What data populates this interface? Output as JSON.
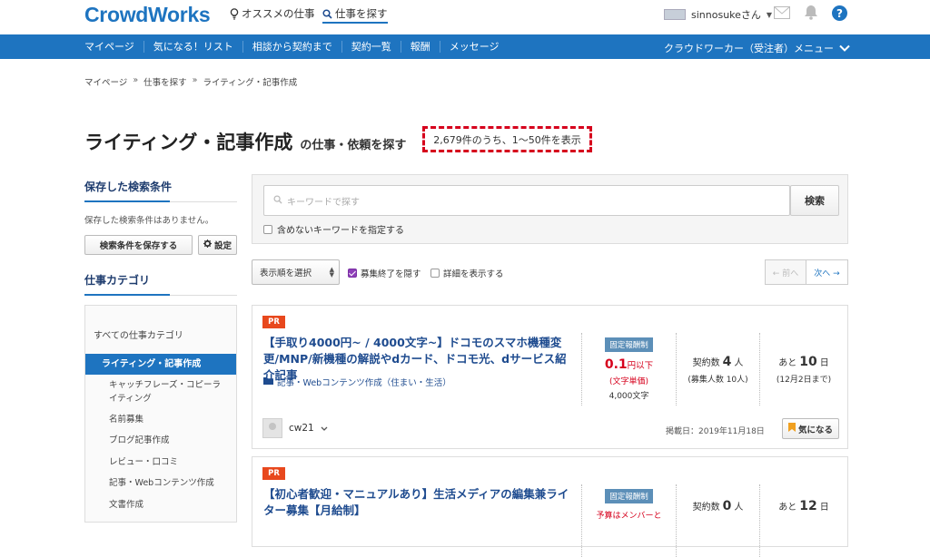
{
  "header": {
    "logo": "CrowdWorks",
    "recommend": "オススメの仕事",
    "find_jobs": "仕事を探す",
    "username": "sinnosukeさん"
  },
  "nav": {
    "items": [
      "マイページ",
      "気になる！リスト",
      "相談から契約まで",
      "契約一覧",
      "報酬",
      "メッセージ"
    ],
    "menu": "クラウドワーカー（受注者）メニュー"
  },
  "breadcrumb": {
    "items": [
      "マイページ",
      "仕事を探す",
      "ライティング・記事作成"
    ],
    "sep": "»"
  },
  "page": {
    "title": "ライティング・記事作成",
    "subtitle": "の仕事・依頼を探す",
    "count": "2,679件のうち、1〜50件を表示"
  },
  "sidebar": {
    "saved_title": "保存した検索条件",
    "saved_none": "保存した検索条件はありません。",
    "save_button": "検索条件を保存する",
    "settings_button": "設定",
    "category_title": "仕事カテゴリ",
    "all_categories": "すべての仕事カテゴリ",
    "active_category": "ライティング・記事作成",
    "subcategories": [
      "キャッチフレーズ・コピーライティング",
      "名前募集",
      "ブログ記事作成",
      "レビュー・口コミ",
      "記事・Webコンテンツ作成",
      "文書作成"
    ]
  },
  "search": {
    "placeholder": "キーワードで探す",
    "button": "検索",
    "exclude_label": "含めないキーワードを指定する"
  },
  "toolbar": {
    "sort": "表示順を選択",
    "hide_closed": "募集終了を隠す",
    "show_details": "詳細を表示する",
    "prev": "← 前へ",
    "next": "次へ →"
  },
  "jobs": [
    {
      "pr": "PR",
      "title": "【手取り4000円~ / 4000文字~】ドコモのスマホ機種変更/MNP/新機種の解説やdカード、ドコモ光、dサービス紹介記事",
      "category": "記事・Webコンテンツ作成（住まい・生活）",
      "pay_type": "固定報酬制",
      "price": "0.1",
      "price_unit": "円以下",
      "price_note": "(文字単価)",
      "chars": "4,000文字",
      "contracts_label": "契約数",
      "contracts": "4",
      "people": "人",
      "recruit": "(募集人数 10人)",
      "remaining_label": "あと",
      "remaining": "10",
      "days": "日",
      "deadline": "(12月2日まで)",
      "client": "cw21",
      "posted": "掲載日：2019年11月18日",
      "fav": "気になる"
    },
    {
      "pr": "PR",
      "title": "【初心者歓迎・マニュアルあり】生活メディアの編集兼ライター募集【月給制】",
      "pay_type": "固定報酬制",
      "price_note": "予算はメンバーと",
      "contracts_label": "契約数",
      "contracts": "0",
      "people": "人",
      "remaining_label": "あと",
      "remaining": "12",
      "days": "日"
    }
  ],
  "colors": {
    "brand": "#1e74c0",
    "accent_red": "#d6001c",
    "pr_orange": "#e8481d"
  }
}
